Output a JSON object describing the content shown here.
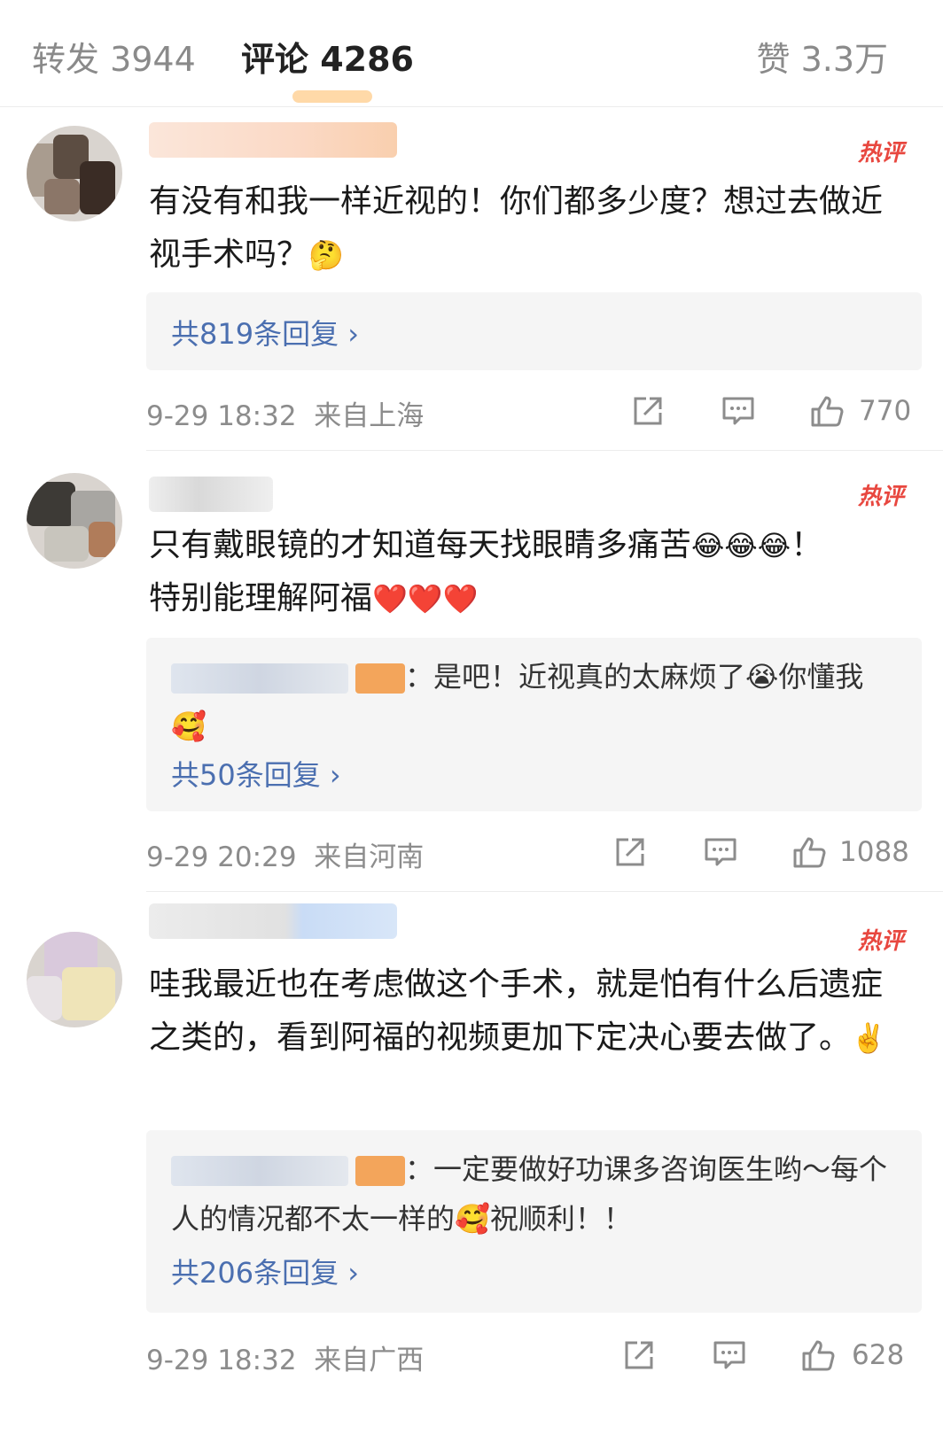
{
  "tabs": {
    "repost_label": "转发 3944",
    "comment_label": "评论 4286",
    "like_label": "赞 3.3万"
  },
  "comments": [
    {
      "hot_label": "热评",
      "text": "有没有和我一样近视的！你们都多少度？想过去做近视手术吗？",
      "emoji": "🤔",
      "reply_link": "共819条回复 ›",
      "time": "9-29 18:32",
      "location": "来自上海",
      "likes": "770"
    },
    {
      "hot_label": "热评",
      "text": "只有戴眼镜的才知道每天找眼睛多痛苦",
      "emoji": "😂😂😂",
      "text_suffix": "！",
      "text2": "特别能理解阿福",
      "emoji2": "❤️❤️❤️",
      "reply_text": "：是吧！近视真的太麻烦了",
      "reply_emoji": "😭",
      "reply_text2": "你懂我",
      "reply_emoji2": "🥰",
      "reply_link": "共50条回复 ›",
      "time": "9-29 20:29",
      "location": "来自河南",
      "likes": "1088"
    },
    {
      "hot_label": "热评",
      "text": "哇我最近也在考虑做这个手术，就是怕有什么后遗症之类的，看到阿福的视频更加下定决心要去做了。",
      "emoji": "✌️",
      "reply_text": "：一定要做好功课多咨询医生哟～每个人的情况都不太一样的",
      "reply_emoji": "🥰",
      "reply_text2": "祝顺利！！",
      "reply_link": "共206条回复 ›",
      "time": "9-29 18:32",
      "location": "来自广西",
      "likes": "628"
    }
  ],
  "icons": {
    "share": "share-icon",
    "comment": "comment-icon",
    "like": "thumbs-up-icon"
  },
  "colors": {
    "hot": "#e8473f",
    "link": "#4b6fb0",
    "reply_bg": "#f5f5f5"
  }
}
